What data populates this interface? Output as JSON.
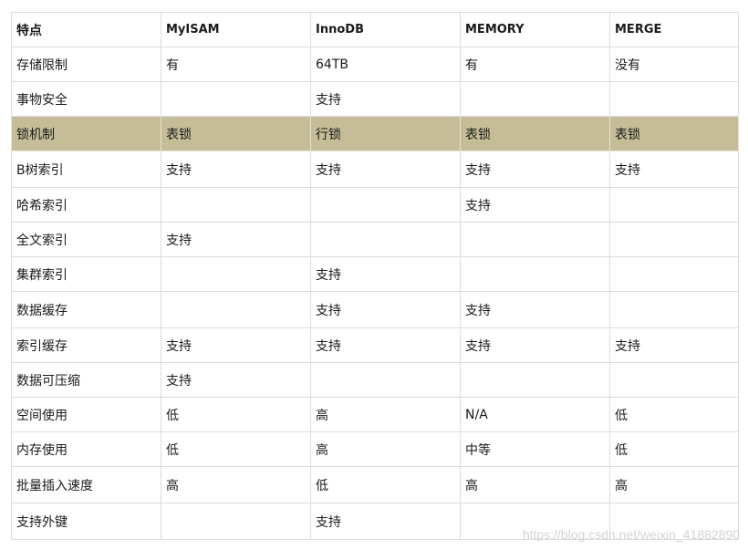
{
  "table": {
    "headers": [
      "特点",
      "MyISAM",
      "InnoDB",
      "MEMORY",
      "MERGE"
    ],
    "highlight_color": "#c4bd97",
    "rows": [
      [
        "存储限制",
        "有",
        "64TB",
        "有",
        "没有"
      ],
      [
        "事物安全",
        "",
        "支持",
        "",
        ""
      ],
      [
        "锁机制",
        "表锁",
        "行锁",
        "表锁",
        "表锁"
      ],
      [
        "B树索引",
        "支持",
        "支持",
        "支持",
        "支持"
      ],
      [
        "哈希索引",
        "",
        "",
        "支持",
        ""
      ],
      [
        "全文索引",
        "支持",
        "",
        "",
        ""
      ],
      [
        "集群索引",
        "",
        "支持",
        "",
        ""
      ],
      [
        "数据缓存",
        "",
        "支持",
        "支持",
        ""
      ],
      [
        "索引缓存",
        "支持",
        "支持",
        "支持",
        "支持"
      ],
      [
        "数据可压缩",
        "支持",
        "",
        "",
        ""
      ],
      [
        "空间使用",
        "低",
        "高",
        "N/A",
        "低"
      ],
      [
        "内存使用",
        "低",
        "高",
        "中等",
        "低"
      ],
      [
        "批量插入速度",
        "高",
        "低",
        "高",
        "高"
      ],
      [
        "支持外键",
        "",
        "支持",
        "",
        ""
      ]
    ]
  },
  "watermark": "https://blog.csdn.net/weixin_41882890"
}
